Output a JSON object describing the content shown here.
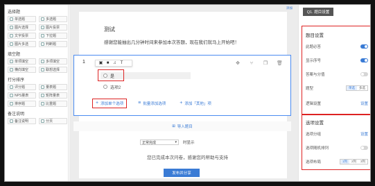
{
  "left": {
    "sections": [
      {
        "title": "选择题",
        "buttons": [
          "单选题",
          "多选题",
          "图片选择",
          "图片投票",
          "文字投票",
          "下拉题",
          "图片多选",
          "判断题"
        ]
      },
      {
        "title": "填空题",
        "buttons": [
          "单项填空",
          "多项填空",
          "横向填空",
          "联想选择"
        ]
      },
      {
        "title": "打分排序",
        "buttons": [
          "评分题",
          "量表题",
          "NPS量表",
          "矩阵量表",
          "排序题",
          "比重题"
        ]
      },
      {
        "title": "备注说明",
        "buttons": [
          "备注说明",
          "分页"
        ]
      }
    ]
  },
  "middle": {
    "top_link": "添加",
    "survey_title": "测试",
    "survey_desc": "感谢您能抽出几分钟时间来参加本次答题，现在我们就马上开始吧！",
    "question": {
      "number": "1",
      "options": [
        "是",
        "选项2"
      ],
      "add_single": "添加单个选项",
      "add_batch": "批量添加选项",
      "add_other": "添加「其他」项"
    },
    "import_label": "导入题目",
    "end": {
      "select_value": "正常完成",
      "suffix": "时显示",
      "thanks": "您已完成本次问卷，感谢您的帮助与支持",
      "publish": "发布并分享"
    }
  },
  "right": {
    "tab": "Q1. 题目设置",
    "question_settings": {
      "title": "题目设置",
      "rows": [
        {
          "label": "此题必答",
          "on": true
        },
        {
          "label": "显示序号",
          "on": true
        },
        {
          "label": "答案与分值",
          "on": false
        }
      ],
      "type_label": "题型",
      "type_options": [
        "单选",
        "多选"
      ],
      "logic_label": "逻辑设置",
      "logic_link": "设置"
    },
    "option_settings": {
      "title": "选项设置",
      "group_label": "选项分组",
      "group_link": "设置",
      "random_label": "选项随机排列",
      "layout_label": "选项布局",
      "layout_options": [
        "1列",
        "2列",
        "3列"
      ]
    },
    "accent_color": "#3a7bd5",
    "highlight_color": "#dd2222"
  }
}
